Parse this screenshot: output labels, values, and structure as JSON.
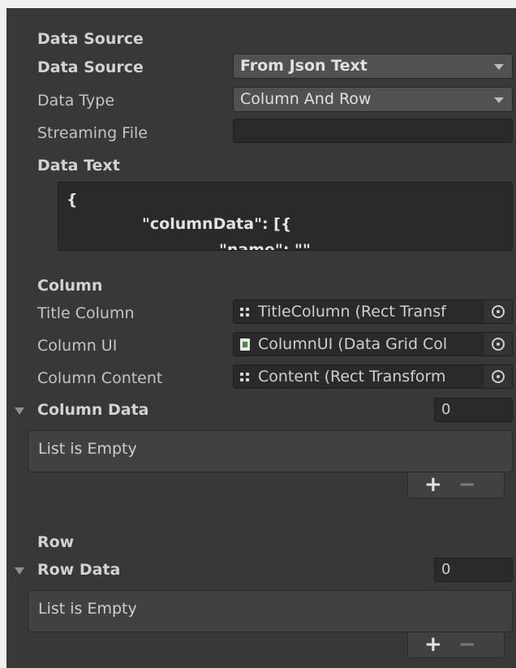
{
  "data_source_section": {
    "header": "Data Source",
    "data_source": {
      "label": "Data Source",
      "value": "From Json Text"
    },
    "data_type": {
      "label": "Data Type",
      "value": "Column And Row"
    },
    "streaming_file": {
      "label": "Streaming File",
      "value": ""
    },
    "data_text": {
      "label": "Data Text",
      "lines": [
        "{",
        "\"columnData\": [{",
        "\"name\": \"\""
      ]
    }
  },
  "column_section": {
    "header": "Column",
    "title_column": {
      "label": "Title Column",
      "value": "TitleColumn (Rect Transf",
      "icon": "rect-transform-icon"
    },
    "column_ui": {
      "label": "Column UI",
      "value": "ColumnUI (Data Grid Col",
      "icon": "script-icon"
    },
    "column_content": {
      "label": "Column Content",
      "value": "Content (Rect Transform",
      "icon": "rect-transform-icon"
    },
    "column_data": {
      "label": "Column Data",
      "count": "0",
      "empty_text": "List is Empty",
      "add": "+",
      "remove": "−"
    }
  },
  "row_section": {
    "header": "Row",
    "row_data": {
      "label": "Row Data",
      "count": "0",
      "empty_text": "List is Empty",
      "add": "+",
      "remove": "−"
    }
  },
  "colors": {
    "panel_bg": "#383838",
    "field_bg": "#2a2a2a",
    "dropdown_bg": "#515151",
    "text": "#c4c4c4"
  }
}
